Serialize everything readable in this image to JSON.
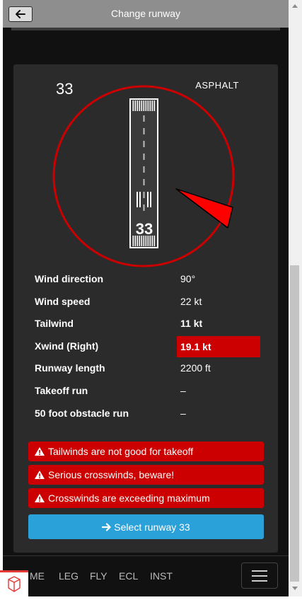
{
  "header": {
    "title": "Change runway",
    "back_icon": "arrow-left-icon"
  },
  "runway": {
    "number": "33",
    "surface": "ASPHALT",
    "painted_number": "33",
    "heading_deg": 330,
    "wind_arrow_from_deg": 90,
    "circle_color": "#cc0000",
    "wind_arrow_color": "#ff0000"
  },
  "conditions": [
    {
      "label": "Wind direction",
      "value": "90°",
      "style": "normal"
    },
    {
      "label": "Wind speed",
      "value": "22 kt",
      "style": "normal"
    },
    {
      "label": "Tailwind",
      "value": "11 kt",
      "style": "bold"
    },
    {
      "label": "Xwind (Right)",
      "value": "19.1 kt",
      "style": "danger"
    },
    {
      "label": "Runway length",
      "value": "2200 ft",
      "style": "normal"
    },
    {
      "label": "Takeoff run",
      "value": "–",
      "style": "normal"
    },
    {
      "label": "50 foot obstacle run",
      "value": "–",
      "style": "normal"
    }
  ],
  "alerts": [
    {
      "text": "Tailwinds are not good for takeoff",
      "icon": "warning-icon"
    },
    {
      "text": "Serious crosswinds, beware!",
      "icon": "warning-icon"
    },
    {
      "text": "Crosswinds are exceeding maximum",
      "icon": "warning-icon"
    }
  ],
  "select_button": {
    "label": "Select runway 33",
    "icon": "arrow-right-icon"
  },
  "bottom_nav": {
    "items": [
      "ME",
      "LEG",
      "FLY",
      "ECL",
      "INST"
    ],
    "menu_icon": "hamburger-icon"
  },
  "colors": {
    "danger": "#cc0000",
    "primary_button": "#2aa1d8",
    "card": "#2b2b2b",
    "header": "#8e8e8e"
  }
}
